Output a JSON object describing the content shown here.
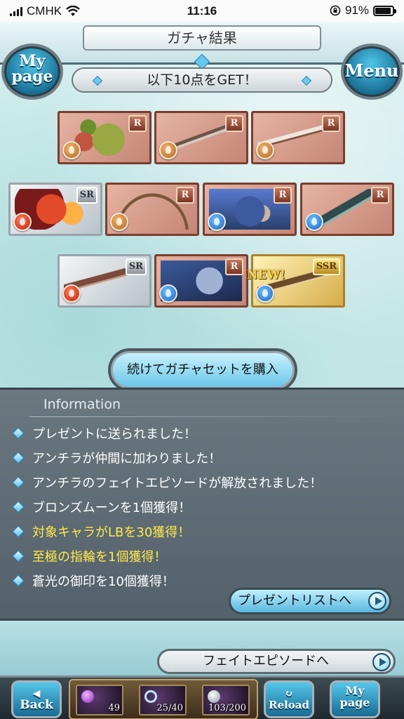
{
  "status_bar": {
    "carrier": "CMHK",
    "time": "11:16",
    "battery_percent": "91%",
    "battery_level": 0.91
  },
  "header": {
    "title": "ガチャ結果",
    "mypage_label_line1": "My",
    "mypage_label_line2": "page",
    "menu_label": "Menu"
  },
  "result_banner": "以下10点をGET！",
  "items": [
    {
      "rarity": "R",
      "element": "earth",
      "kind": "summon-turtle"
    },
    {
      "rarity": "R",
      "element": "earth",
      "kind": "sword"
    },
    {
      "rarity": "R",
      "element": "earth",
      "kind": "blade"
    },
    {
      "rarity": "SR",
      "element": "fire",
      "kind": "summon-fire"
    },
    {
      "rarity": "R",
      "element": "earth",
      "kind": "bow"
    },
    {
      "rarity": "R",
      "element": "water",
      "kind": "summon-beast"
    },
    {
      "rarity": "R",
      "element": "water",
      "kind": "dagger"
    },
    {
      "rarity": "SR",
      "element": "fire",
      "kind": "gun"
    },
    {
      "rarity": "R",
      "element": "water",
      "kind": "summon-dragon"
    },
    {
      "rarity": "SSR",
      "element": "water",
      "kind": "staff",
      "new": true
    }
  ],
  "new_label": "NEW!",
  "buy_again_label": "続けてガチャセットを購入",
  "information": {
    "heading": "Information",
    "lines": [
      {
        "text": "プレゼントに送られました！",
        "highlight": false
      },
      {
        "text": "アンチラが仲間に加わりました！",
        "highlight": false
      },
      {
        "text": "アンチラのフェイトエピソードが解放されました！",
        "highlight": false
      },
      {
        "text": "ブロンズムーンを1個獲得！",
        "highlight": false
      },
      {
        "text": "対象キャラがLBを30獲得！",
        "highlight": true
      },
      {
        "text": "至極の指輪を1個獲得！",
        "highlight": true
      },
      {
        "text": "蒼光の御印を10個獲得！",
        "highlight": false
      }
    ],
    "present_list_label": "プレゼントリストへ"
  },
  "fate_episode_label": "フェイトエピソードへ",
  "bottom_nav": {
    "back_label": "Back",
    "reload_label": "Reload",
    "mypage_line1": "My",
    "mypage_line2": "page",
    "stats": [
      "49",
      "25/40",
      "103/200"
    ]
  },
  "colors": {
    "highlight_text": "#ffe94a",
    "accent_blue": "#55c6ea",
    "panel_bg": "#5f6c74"
  }
}
